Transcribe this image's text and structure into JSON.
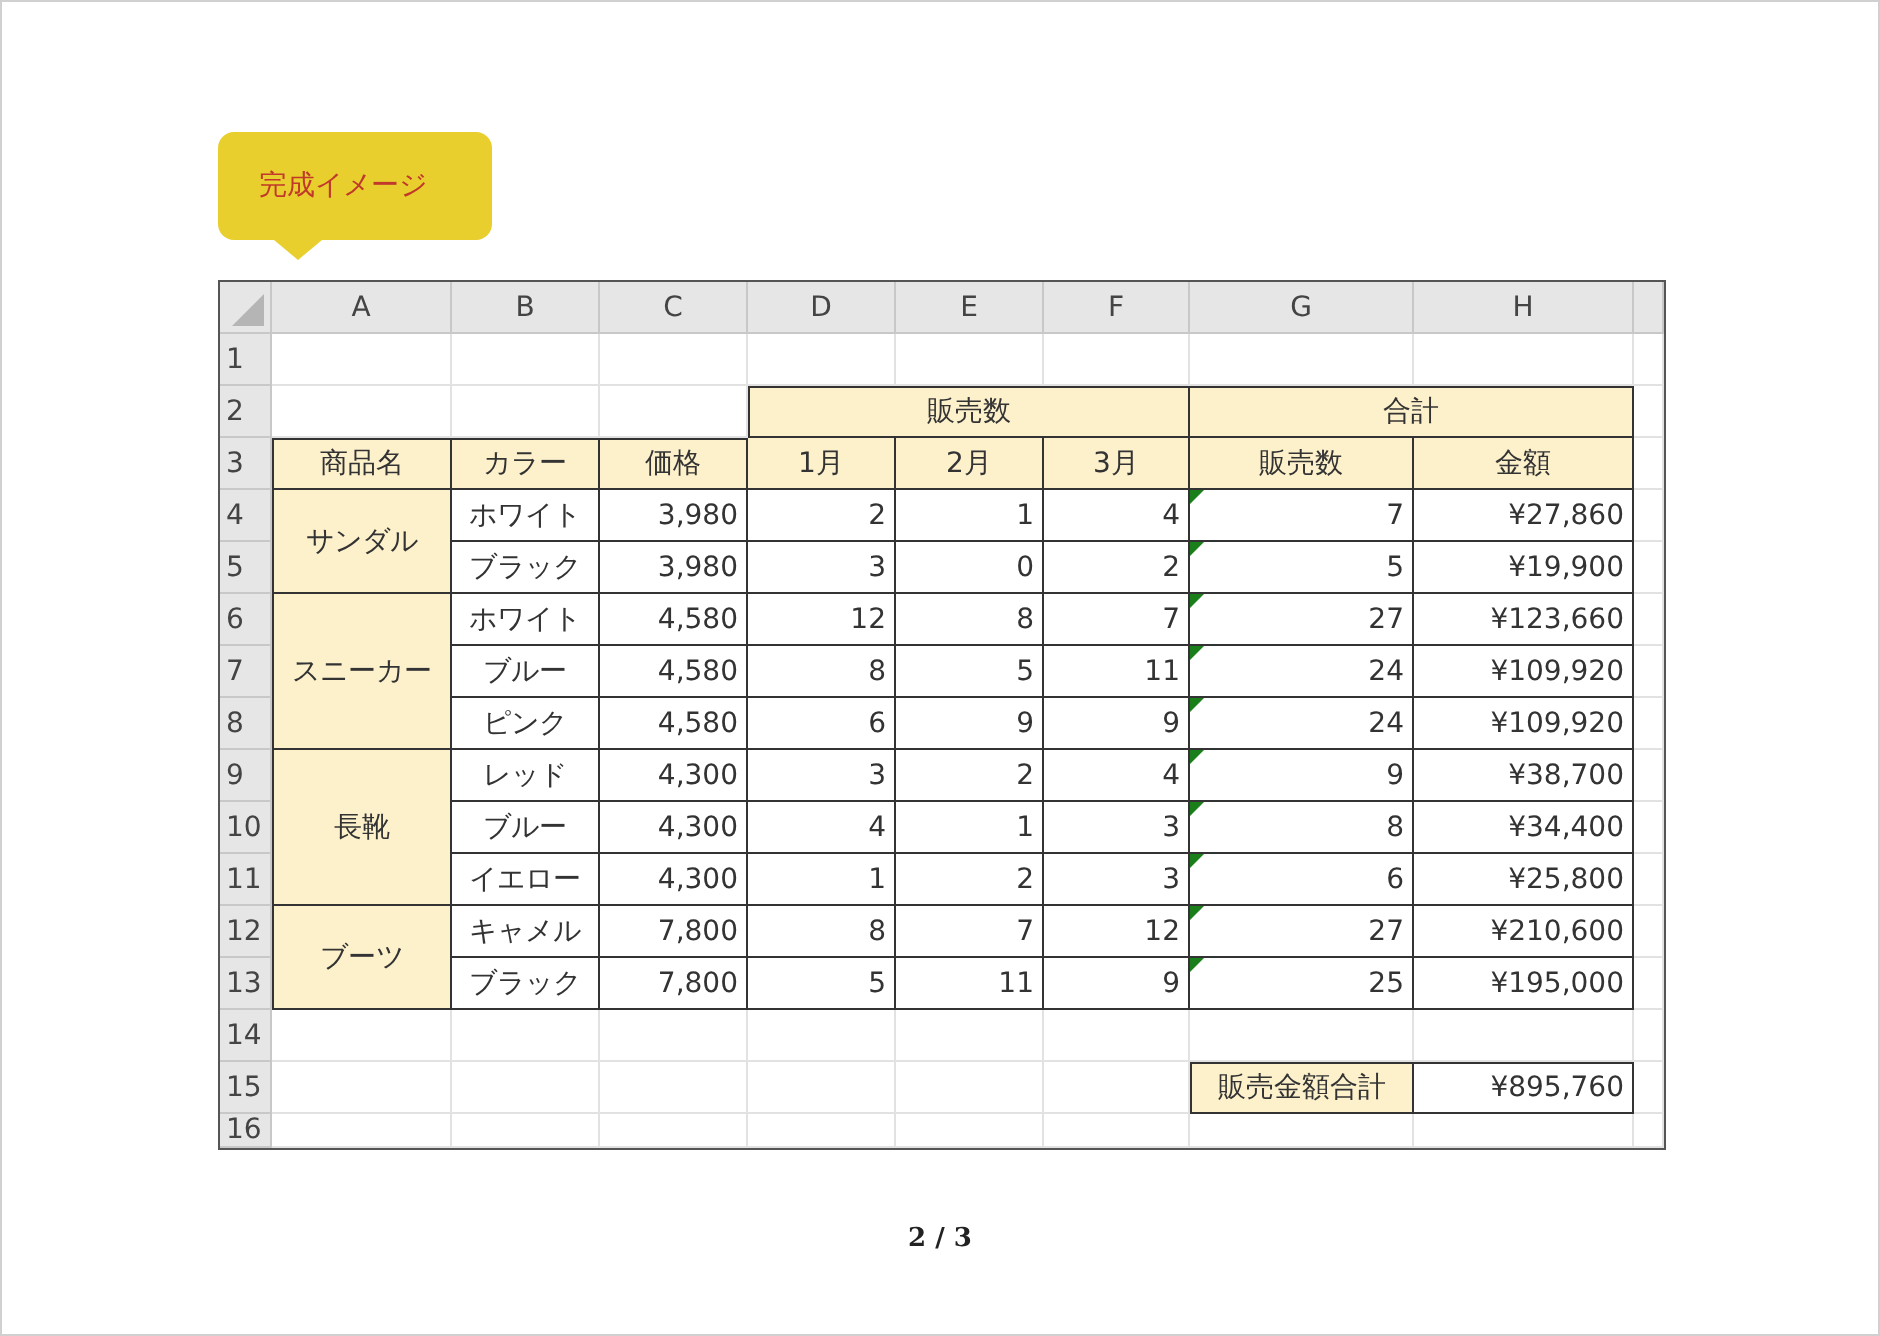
{
  "badge": {
    "label": "完成イメージ"
  },
  "sheet": {
    "columns": [
      "A",
      "B",
      "C",
      "D",
      "E",
      "F",
      "G",
      "H"
    ],
    "rows": [
      "1",
      "2",
      "3",
      "4",
      "5",
      "6",
      "7",
      "8",
      "9",
      "10",
      "11",
      "12",
      "13",
      "14",
      "15",
      "16"
    ],
    "group_headers": [
      {
        "label": "販売数"
      },
      {
        "label": "合計"
      }
    ],
    "headers": [
      "商品名",
      "カラー",
      "価格",
      "1月",
      "2月",
      "3月",
      "販売数",
      "金額"
    ],
    "products": [
      {
        "name": "サンダル",
        "variants": [
          {
            "variant": "ホワイト",
            "price": "3,980",
            "months": [
              "2",
              "1",
              "4"
            ],
            "qty": "7",
            "amount": "¥27,860",
            "flagged": true
          },
          {
            "variant": "ブラック",
            "price": "3,980",
            "months": [
              "3",
              "0",
              "2"
            ],
            "qty": "5",
            "amount": "¥19,900",
            "flagged": true
          }
        ]
      },
      {
        "name": "スニーカー",
        "variants": [
          {
            "variant": "ホワイト",
            "price": "4,580",
            "months": [
              "12",
              "8",
              "7"
            ],
            "qty": "27",
            "amount": "¥123,660",
            "flagged": true
          },
          {
            "variant": "ブルー",
            "price": "4,580",
            "months": [
              "8",
              "5",
              "11"
            ],
            "qty": "24",
            "amount": "¥109,920",
            "flagged": true
          },
          {
            "variant": "ピンク",
            "price": "4,580",
            "months": [
              "6",
              "9",
              "9"
            ],
            "qty": "24",
            "amount": "¥109,920",
            "flagged": true
          }
        ]
      },
      {
        "name": "長靴",
        "variants": [
          {
            "variant": "レッド",
            "price": "4,300",
            "months": [
              "3",
              "2",
              "4"
            ],
            "qty": "9",
            "amount": "¥38,700",
            "flagged": true
          },
          {
            "variant": "ブルー",
            "price": "4,300",
            "months": [
              "4",
              "1",
              "3"
            ],
            "qty": "8",
            "amount": "¥34,400",
            "flagged": true
          },
          {
            "variant": "イエロー",
            "price": "4,300",
            "months": [
              "1",
              "2",
              "3"
            ],
            "qty": "6",
            "amount": "¥25,800",
            "flagged": true
          }
        ]
      },
      {
        "name": "ブーツ",
        "variants": [
          {
            "variant": "キャメル",
            "price": "7,800",
            "months": [
              "8",
              "7",
              "12"
            ],
            "qty": "27",
            "amount": "¥210,600",
            "flagged": true
          },
          {
            "variant": "ブラック",
            "price": "7,800",
            "months": [
              "5",
              "11",
              "9"
            ],
            "qty": "25",
            "amount": "¥195,000",
            "flagged": true
          }
        ]
      }
    ],
    "total": {
      "label": "販売金額合計",
      "value": "¥895,760"
    }
  },
  "page_indicator": "2 / 3"
}
